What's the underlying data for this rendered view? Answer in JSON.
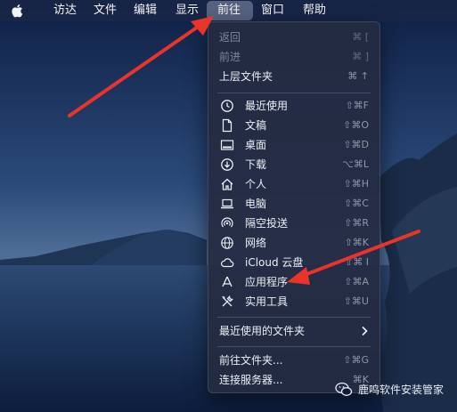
{
  "menubar": {
    "items": [
      "访达",
      "文件",
      "编辑",
      "显示",
      "前往",
      "窗口",
      "帮助"
    ],
    "active": "前往"
  },
  "go_menu": {
    "back": {
      "label": "返回",
      "shortcut": "⌘ ["
    },
    "forward": {
      "label": "前进",
      "shortcut": "⌘ ]"
    },
    "enclosing": {
      "label": "上层文件夹",
      "shortcut": "⌘ ↑"
    },
    "places": [
      {
        "label": "最近使用",
        "shortcut": "⇧⌘F",
        "icon": "clock-icon"
      },
      {
        "label": "文稿",
        "shortcut": "⇧⌘O",
        "icon": "document-icon"
      },
      {
        "label": "桌面",
        "shortcut": "⇧⌘D",
        "icon": "desktop-icon"
      },
      {
        "label": "下载",
        "shortcut": "⌥⌘L",
        "icon": "download-icon"
      },
      {
        "label": "个人",
        "shortcut": "⇧⌘H",
        "icon": "home-icon"
      },
      {
        "label": "电脑",
        "shortcut": "⇧⌘C",
        "icon": "laptop-icon"
      },
      {
        "label": "隔空投送",
        "shortcut": "⇧⌘R",
        "icon": "airdrop-icon"
      },
      {
        "label": "网络",
        "shortcut": "⇧⌘K",
        "icon": "globe-icon"
      },
      {
        "label": "iCloud 云盘",
        "shortcut": "⇧⌘ I",
        "icon": "cloud-icon"
      },
      {
        "label": "应用程序",
        "shortcut": "⇧⌘A",
        "icon": "applications-icon"
      },
      {
        "label": "实用工具",
        "shortcut": "⇧⌘U",
        "icon": "tools-icon"
      }
    ],
    "recent_folders": {
      "label": "最近使用的文件夹"
    },
    "go_to_folder": {
      "label": "前往文件夹...",
      "shortcut": "⇧⌘G"
    },
    "connect_server": {
      "label": "连接服务器...",
      "shortcut": "⌘K"
    }
  },
  "watermark": {
    "text": "鹿鸣软件安装管家"
  },
  "colors": {
    "menu_bg": "#242c42",
    "arrow": "#e8342a",
    "disabled": "#7d8598"
  }
}
